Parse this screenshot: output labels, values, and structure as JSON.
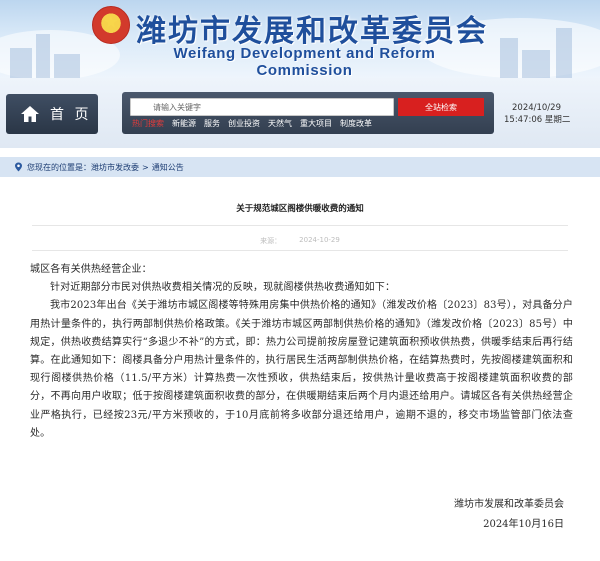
{
  "header": {
    "title": "潍坊市发展和改革委员会",
    "subtitle": "Weifang Development and Reform Commission"
  },
  "nav": {
    "home_label": "首 页",
    "search_placeholder": "请输入关键字",
    "search_button": "全站检索",
    "hot_label": "热门搜索",
    "hot_links": [
      "新能源",
      "服务",
      "创业投资",
      "天然气",
      "重大项目",
      "制度改革"
    ],
    "date": "2024/10/29",
    "time": "15:47:06 星期二"
  },
  "breadcrumb": {
    "prefix": "您现在的位置是：",
    "items": [
      "潍坊市发改委",
      "通知公告"
    ],
    "separator": ">"
  },
  "article": {
    "title": "关于规范城区阁楼供暖收费的通知",
    "meta_source": "来源：",
    "meta_date": "2024-10-29",
    "salutation": "城区各有关供热经营企业：",
    "paragraphs": [
      "针对近期部分市民对供热收费相关情况的反映，现就阁楼供热收费通知如下：",
      "我市2023年出台《关于潍坊市城区阁楼等特殊用房集中供热价格的通知》（潍发改价格〔2023〕83号），对具备分户用热计量条件的，执行两部制供热价格政策。《关于潍坊市城区两部制供热价格的通知》（潍发改价格〔2023〕85号）中规定，供热收费结算实行“多退少不补”的方式，即：热力公司提前按房屋登记建筑面积预收供热费，供暖季结束后再行结算。在此通知如下：阁楼具备分户用热计量条件的，执行居民生活两部制供热价格，在结算热费时，先按阁楼建筑面积和现行阁楼供热价格（11.5/平方米）计算热费一次性预收，供热结束后，按供热计量收费高于按阁楼建筑面积收费的部分，不再向用户收取；低于按阁楼建筑面积收费的部分，在供暖期结束后两个月内退还给用户。请城区各有关供热经营企业严格执行，已经按23元/平方米预收的，于10月底前将多收部分退还给用户，逾期不退的，移交市场监管部门依法查处。"
    ],
    "signature_org": "潍坊市发展和改革委员会",
    "signature_date": "2024年10月16日"
  },
  "colors": {
    "title_blue": "#1f4f9c",
    "search_red": "#d8201f",
    "nav_dark": "#333f50",
    "breadcrumb_bg": "#d7e4f3"
  }
}
